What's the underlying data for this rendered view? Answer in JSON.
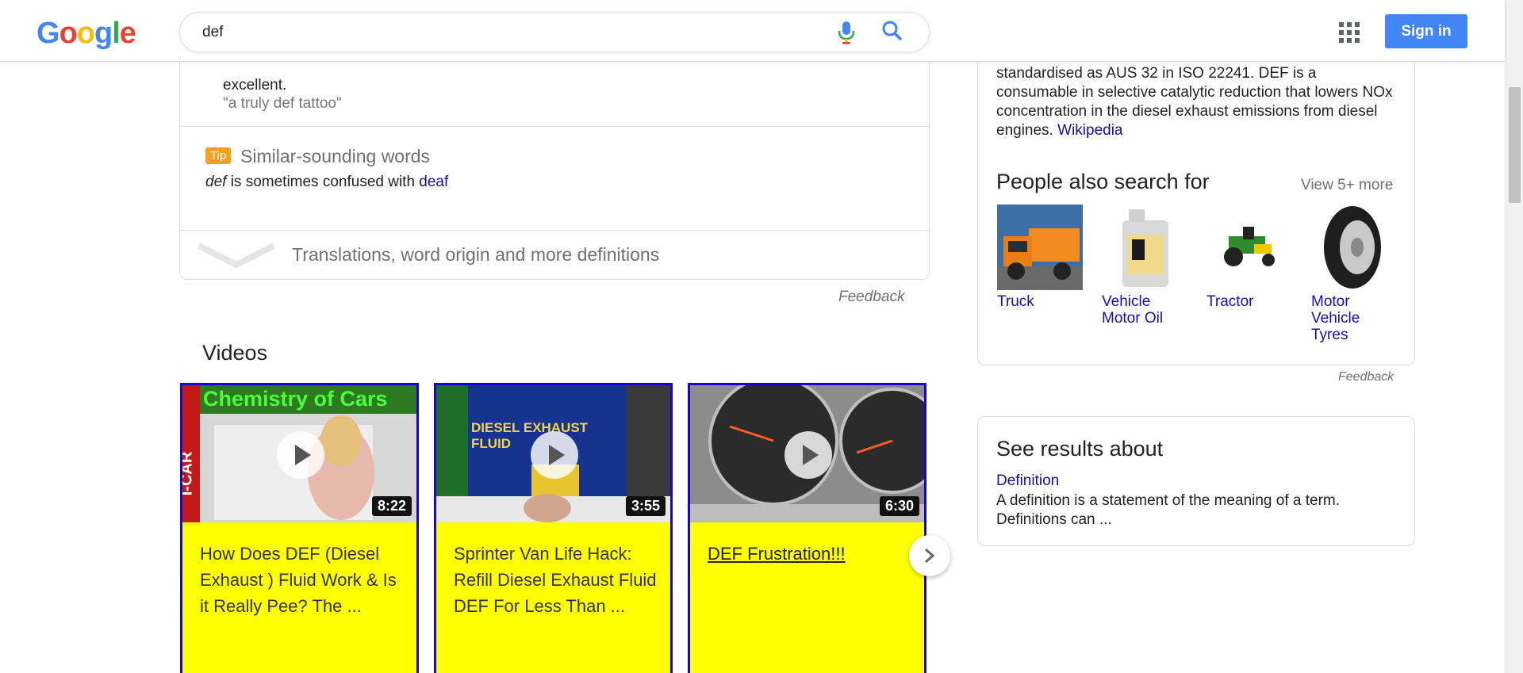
{
  "header": {
    "logo_letters": [
      "G",
      "o",
      "o",
      "g",
      "l",
      "e"
    ],
    "search_value": "def",
    "sign_in_label": "Sign in"
  },
  "dictionary": {
    "definition_text": "excellent.",
    "example": "\"a truly def tattoo\"",
    "tip_label": "Tip",
    "similar_title": "Similar-sounding words",
    "similar_word": "def",
    "similar_mid": " is sometimes confused with ",
    "similar_link": "deaf",
    "more_label": "Translations, word origin and more definitions",
    "feedback": "Feedback"
  },
  "videos": {
    "title": "Videos",
    "items": [
      {
        "duration": "8:22",
        "title": "How Does DEF (Diesel Exhaust ) Fluid Work & Is it Really Pee? The ...",
        "thumb_caption": "Chemistry of Cars",
        "thumb_side": "I-CAR"
      },
      {
        "duration": "3:55",
        "title": "Sprinter Van Life Hack: Refill Diesel Exhaust Fluid DEF For Less Than ...",
        "thumb_caption": "DIESEL EXHAUST FLUID"
      },
      {
        "duration": "6:30",
        "title": "DEF Frustration!!!"
      }
    ]
  },
  "knowledge_panel": {
    "description": "standardised as AUS 32 in ISO 22241. DEF is a consumable in selective catalytic reduction that lowers NOx concentration in the diesel exhaust emissions from diesel engines.",
    "wiki_link": "Wikipedia",
    "people_also_search_title": "People also search for",
    "view_more": "View 5+ more",
    "items": [
      {
        "label": "Truck"
      },
      {
        "label": "Vehicle Motor Oil"
      },
      {
        "label": "Tractor"
      },
      {
        "label": "Motor Vehicle Tyres"
      }
    ],
    "feedback": "Feedback"
  },
  "see_results": {
    "title": "See results about",
    "link": "Definition",
    "description": "A definition is a statement of the meaning of a term. Definitions can ..."
  }
}
